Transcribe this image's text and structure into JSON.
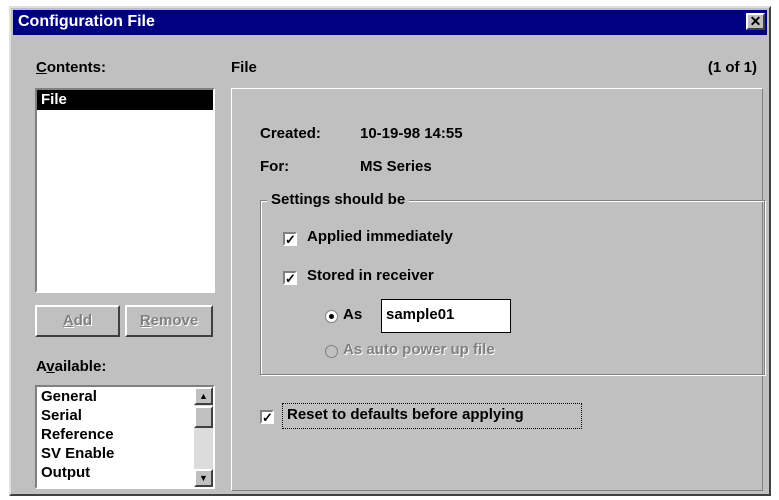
{
  "window": {
    "title": "Configuration File",
    "close_glyph": "✕"
  },
  "contents": {
    "label_prefix": "C",
    "label_rest": "ontents:",
    "items": [
      {
        "label": "File",
        "selected": true
      }
    ]
  },
  "buttons": {
    "add_prefix": "A",
    "add_rest": "dd",
    "remove_prefix": "R",
    "remove_rest": "emove"
  },
  "available": {
    "label_pre": "A",
    "label_u": "v",
    "label_rest": "ailable:",
    "items": [
      "General",
      "Serial",
      "Reference",
      "SV Enable",
      "Output"
    ]
  },
  "scroll_glyphs": {
    "up": "▲",
    "down": "▼"
  },
  "panel": {
    "header_title": "File",
    "page_indicator": "(1 of 1)",
    "created_label": "Created:",
    "created_value": "10-19-98 14:55",
    "for_label": "For:",
    "for_value": "MS Series"
  },
  "settings": {
    "group_label": "Settings should be",
    "applied_label": "Applied immediately",
    "applied_checked": true,
    "stored_label": "Stored in receiver",
    "stored_checked": true,
    "as_label": "As",
    "as_value": "sample01",
    "as_selected": true,
    "auto_label": "As auto power up file",
    "auto_enabled": false
  },
  "reset": {
    "label": "Reset to defaults before applying",
    "checked": true
  },
  "check_glyph": "✓"
}
